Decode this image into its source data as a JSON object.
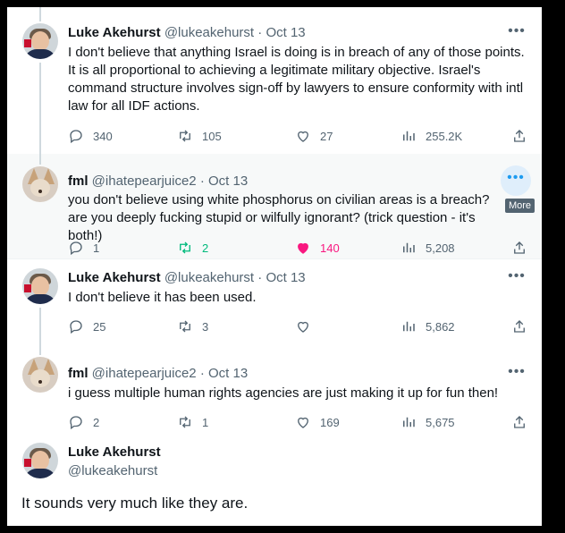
{
  "tweets": [
    {
      "name": "Luke Akehurst",
      "handle": "@lukeakehurst",
      "date": "Oct 13",
      "text": "I don't believe that anything Israel is doing is in breach of any of those points. It is all proportional to achieving a legitimate military objective. Israel's command structure involves sign-off by lawyers to ensure conformity with intl law for all IDF actions.",
      "replies": "340",
      "retweets": "105",
      "likes": "27",
      "views": "255.2K"
    },
    {
      "name": "fml",
      "handle": "@ihatepearjuice2",
      "date": "Oct 13",
      "text": "you don't believe using white phosphorus on civilian areas is a breach? are you deeply fucking stupid or wilfully ignorant? (trick question - it's both!)",
      "replies": "1",
      "retweets": "2",
      "likes": "140",
      "views": "5,208",
      "tooltip": "More"
    },
    {
      "name": "Luke Akehurst",
      "handle": "@lukeakehurst",
      "date": "Oct 13",
      "text": "I don't believe it has been used.",
      "replies": "25",
      "retweets": "3",
      "likes": "",
      "views": "5,862"
    },
    {
      "name": "fml",
      "handle": "@ihatepearjuice2",
      "date": "Oct 13",
      "text": "i guess multiple human rights agencies are just making it up for fun then!",
      "replies": "2",
      "retweets": "1",
      "likes": "169",
      "views": "5,675"
    }
  ],
  "focused": {
    "name": "Luke Akehurst",
    "handle": "@lukeakehurst",
    "text": "It sounds very much like they are."
  },
  "sep": "·",
  "more_glyph": "•••",
  "colors": {
    "retweet_active": "#00ba7c",
    "like_active": "#f91880",
    "accent": "#1d9bf0"
  },
  "icons": [
    "reply-icon",
    "retweet-icon",
    "like-icon",
    "views-icon",
    "share-icon",
    "more-icon"
  ]
}
